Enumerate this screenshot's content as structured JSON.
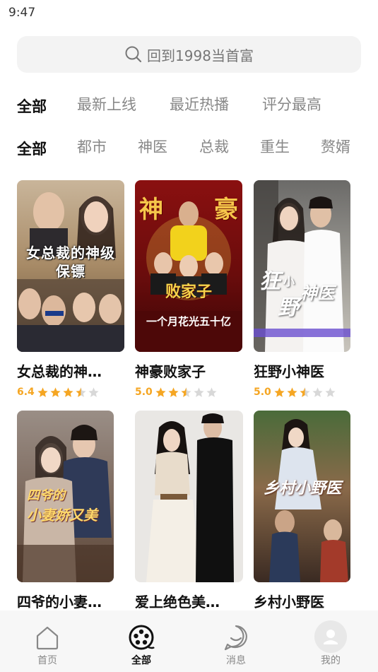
{
  "status_bar": {
    "time": "9:47"
  },
  "search": {
    "placeholder_text": "回到1998当首富"
  },
  "filter_sort": {
    "items": [
      "全部",
      "最新上线",
      "最近热播",
      "评分最高"
    ]
  },
  "filter_genre": {
    "items": [
      "全部",
      "都市",
      "神医",
      "总裁",
      "重生",
      "赘婿"
    ]
  },
  "dramas": [
    {
      "title": "女总裁的神…",
      "score": "6.4",
      "stars": 3.5,
      "poster_text": "女总裁的神级保镖"
    },
    {
      "title": "神豪败家子",
      "score": "5.0",
      "stars": 2.5,
      "poster_text": "神豪败家子",
      "poster_sub": "一个月花光五十亿"
    },
    {
      "title": "狂野小神医",
      "score": "5.0",
      "stars": 2.5,
      "poster_text": "狂野小神医"
    },
    {
      "title": "四爷的小妻…",
      "poster_text": "四爷的小妻娇又美"
    },
    {
      "title": "爱上绝色美…"
    },
    {
      "title": "乡村小野医",
      "poster_text": "乡村小野医"
    }
  ],
  "bottom_nav": {
    "items": [
      {
        "label": "首页",
        "icon": "home-icon"
      },
      {
        "label": "全部",
        "icon": "film-reel-icon"
      },
      {
        "label": "消息",
        "icon": "message-icon"
      },
      {
        "label": "我的",
        "icon": "avatar-icon"
      }
    ]
  },
  "colors": {
    "accent": "#f5a623",
    "star_empty": "#d8d8d8",
    "text_muted": "#888888"
  }
}
